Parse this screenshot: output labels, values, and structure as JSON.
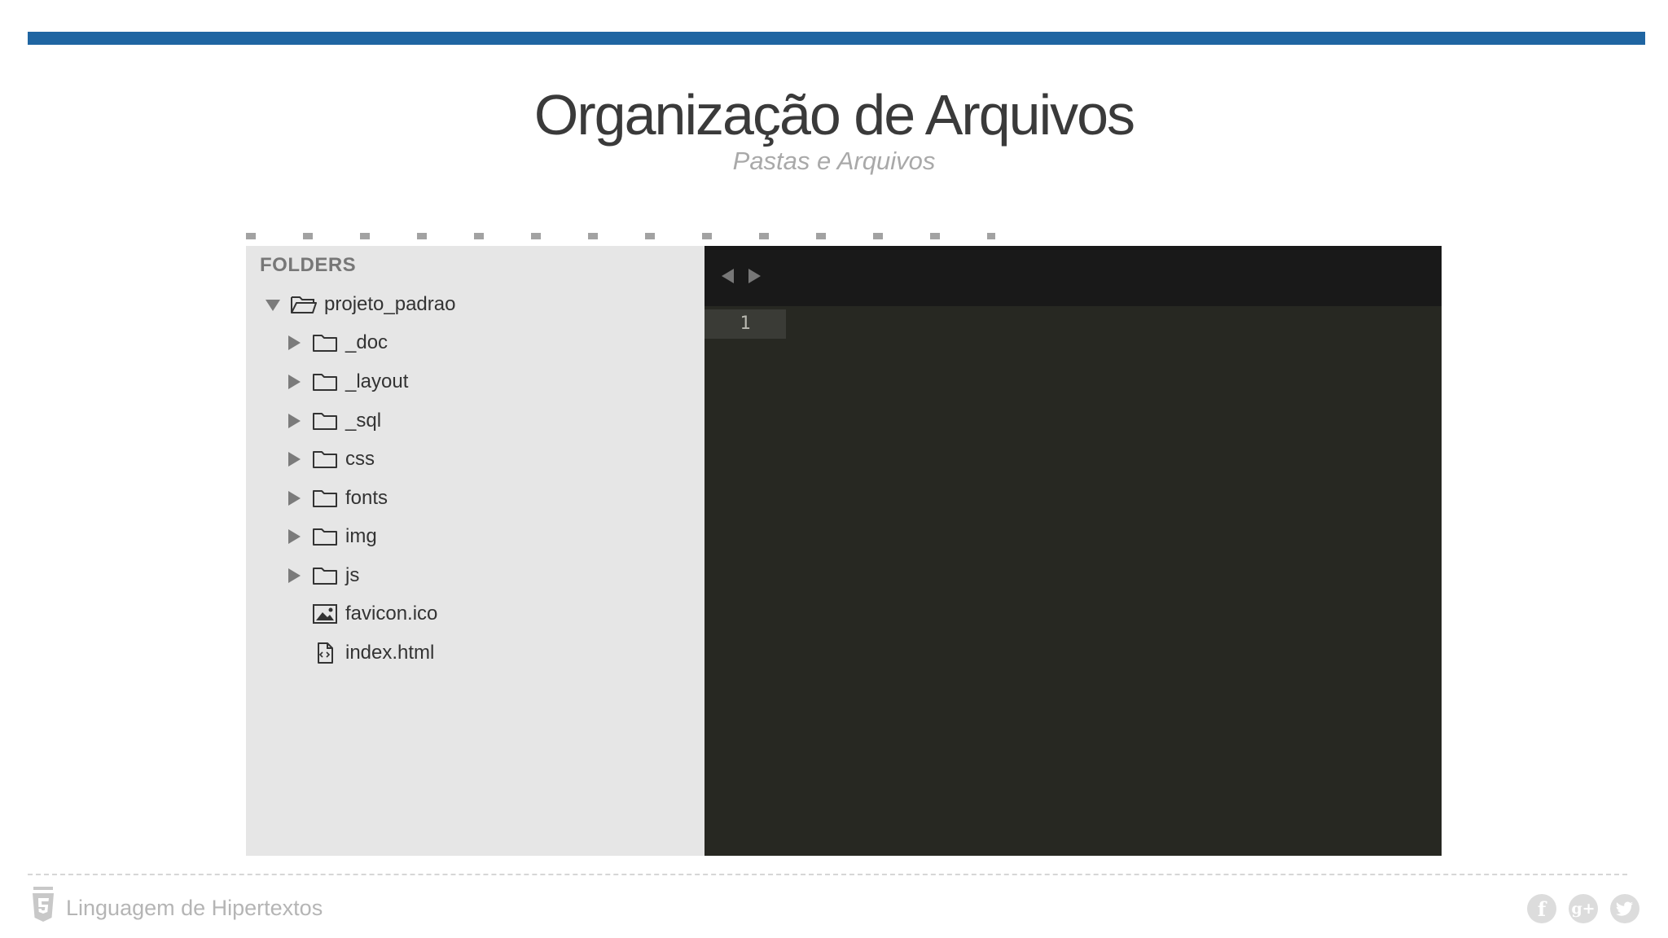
{
  "slide": {
    "title": "Organização de Arquivos",
    "subtitle": "Pastas e Arquivos",
    "accent_color": "#1f65a2"
  },
  "sidebar": {
    "heading": "FOLDERS",
    "root": {
      "label": "projeto_padrao",
      "icon": "folder-open-icon",
      "expanded": true
    },
    "folders": [
      {
        "label": "_doc",
        "icon": "folder-icon",
        "expanded": false
      },
      {
        "label": "_layout",
        "icon": "folder-icon",
        "expanded": false
      },
      {
        "label": "_sql",
        "icon": "folder-icon",
        "expanded": false
      },
      {
        "label": "css",
        "icon": "folder-icon",
        "expanded": false
      },
      {
        "label": "fonts",
        "icon": "folder-icon",
        "expanded": false
      },
      {
        "label": "img",
        "icon": "folder-icon",
        "expanded": false
      },
      {
        "label": "js",
        "icon": "folder-icon",
        "expanded": false
      }
    ],
    "files": [
      {
        "label": "favicon.ico",
        "icon": "image-file-icon"
      },
      {
        "label": "index.html",
        "icon": "code-file-icon"
      }
    ]
  },
  "editor": {
    "line_numbers": [
      "1"
    ],
    "background": "#272822",
    "tabbar_background": "#191919"
  },
  "footer": {
    "text": "Linguagem de Hipertextos",
    "logo_icon": "html5-shield-icon",
    "social": [
      {
        "icon": "facebook-icon",
        "glyph": "f"
      },
      {
        "icon": "google-plus-icon",
        "glyph": "g+"
      },
      {
        "icon": "twitter-icon",
        "glyph": "t"
      }
    ]
  }
}
